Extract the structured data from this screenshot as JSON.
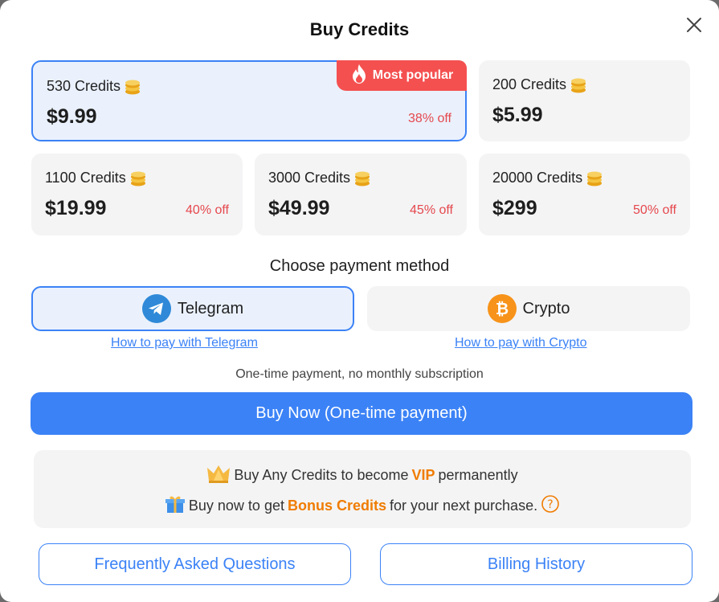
{
  "dialog": {
    "title": "Buy Credits"
  },
  "packages": [
    {
      "credits": "530 Credits",
      "price": "$9.99",
      "discount": "38% off",
      "badge": "Most popular",
      "selected": true
    },
    {
      "credits": "200 Credits",
      "price": "$5.99",
      "discount": ""
    },
    {
      "credits": "1100 Credits",
      "price": "$19.99",
      "discount": "40% off"
    },
    {
      "credits": "3000 Credits",
      "price": "$49.99",
      "discount": "45% off"
    },
    {
      "credits": "20000 Credits",
      "price": "$299",
      "discount": "50% off"
    }
  ],
  "payment": {
    "label": "Choose payment method",
    "methods": [
      {
        "name": "Telegram",
        "icon": "telegram-icon",
        "howto": "How to pay with Telegram",
        "selected": true
      },
      {
        "name": "Crypto",
        "icon": "bitcoin-icon",
        "howto": "How to pay with Crypto",
        "selected": false
      }
    ]
  },
  "note": "One-time payment, no monthly subscription",
  "buy_button": "Buy Now (One-time payment)",
  "perks": {
    "vip": {
      "pre": "Buy Any Credits to become",
      "highlight": "VIP",
      "post": "permanently"
    },
    "bonus": {
      "pre": "Buy now to get",
      "highlight": "Bonus Credits",
      "post": "for your next purchase."
    }
  },
  "footer": {
    "faq": "Frequently Asked Questions",
    "billing": "Billing History"
  },
  "colors": {
    "accent": "#3b82f6",
    "discount": "#e5484d",
    "badge": "#f45050",
    "highlight": "#f07c00"
  }
}
